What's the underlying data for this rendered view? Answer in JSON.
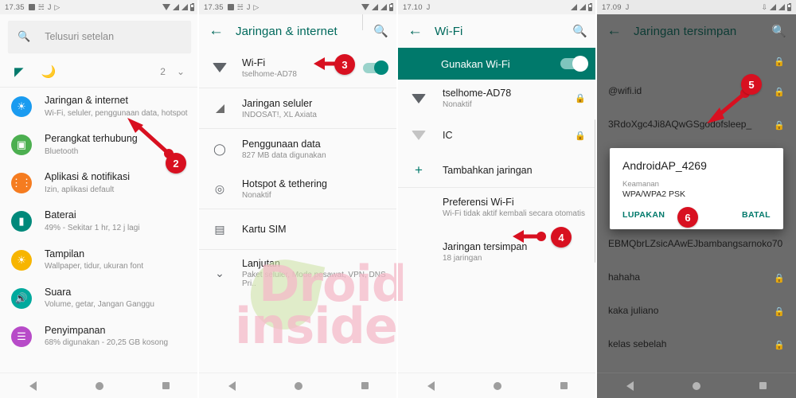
{
  "panels": [
    {
      "id": "settings",
      "statusbar": {
        "time": "17.35",
        "left_icons": [
          "square-icon",
          "message-icon",
          "jpay-icon",
          "play-icon"
        ],
        "right_icons": [
          "wifi-icon",
          "signal-icon",
          "signal-battery-icon"
        ]
      },
      "search": {
        "placeholder": "Telusuri setelan",
        "icon": "search-icon"
      },
      "quick": {
        "icons": [
          "signal-off-icon",
          "moon-icon"
        ],
        "count": "2",
        "chevron": "chevron-down-icon"
      },
      "items": [
        {
          "title": "Jaringan & internet",
          "subtitle": "Wi-Fi, seluler, penggunaan data, hotspot",
          "icon": "network-icon",
          "color": "#1a9bf0"
        },
        {
          "title": "Perangkat terhubung",
          "subtitle": "Bluetooth",
          "icon": "devices-icon",
          "color": "#4caf50"
        },
        {
          "title": "Aplikasi & notifikasi",
          "subtitle": "Izin, aplikasi default",
          "icon": "apps-icon",
          "color": "#f57c20"
        },
        {
          "title": "Baterai",
          "subtitle": "49% - Sekitar 1 hr, 12 j lagi",
          "icon": "battery-icon",
          "color": "#00897b"
        },
        {
          "title": "Tampilan",
          "subtitle": "Wallpaper, tidur, ukuran font",
          "icon": "display-icon",
          "color": "#f7b500"
        },
        {
          "title": "Suara",
          "subtitle": "Volume, getar, Jangan Ganggu",
          "icon": "sound-icon",
          "color": "#00a99d"
        },
        {
          "title": "Penyimpanan",
          "subtitle": "68% digunakan - 20,25 GB kosong",
          "icon": "storage-icon",
          "color": "#b74bc8"
        }
      ]
    },
    {
      "id": "network",
      "statusbar": {
        "time": "17.35"
      },
      "appbar": {
        "title": "Jaringan & internet",
        "back": "back-arrow-icon",
        "search": "search-icon"
      },
      "items": [
        {
          "title": "Wi-Fi",
          "subtitle": "tselhome-AD78",
          "icon": "wifi-icon",
          "toggle": true
        },
        {
          "title": "Jaringan seluler",
          "subtitle": "INDOSAT!, XL Axiata",
          "icon": "signal-icon"
        },
        {
          "title": "Penggunaan data",
          "subtitle": "827 MB data digunakan",
          "icon": "data-usage-icon"
        },
        {
          "title": "Hotspot & tethering",
          "subtitle": "Nonaktif",
          "icon": "hotspot-icon"
        },
        {
          "title": "Kartu SIM",
          "subtitle": "",
          "icon": "sim-card-icon"
        },
        {
          "title": "Lanjutan",
          "subtitle": "Paket seluler, Mode pesawat, VPN, DNS Pri..",
          "icon": "chevron-down-icon"
        }
      ]
    },
    {
      "id": "wifi",
      "statusbar": {
        "time": "17.10"
      },
      "appbar": {
        "title": "Wi-Fi",
        "back": "back-arrow-icon",
        "search": "search-icon"
      },
      "banner": {
        "label": "Gunakan Wi-Fi",
        "on": true
      },
      "networks": [
        {
          "name": "tselhome-AD78",
          "status": "Nonaktif",
          "locked": true,
          "strong": true
        },
        {
          "name": "IC",
          "status": "",
          "locked": true,
          "strong": false
        }
      ],
      "add_network": {
        "label": "Tambahkan jaringan",
        "icon": "plus-icon"
      },
      "prefs": {
        "title": "Preferensi Wi-Fi",
        "subtitle": "Wi-Fi tidak aktif kembali secara otomatis"
      },
      "saved": {
        "title": "Jaringan tersimpan",
        "subtitle": "18 jaringan"
      }
    },
    {
      "id": "saved",
      "statusbar": {
        "time": "17.09"
      },
      "appbar": {
        "title": "Jaringan tersimpan",
        "back": "back-arrow-icon",
        "search": "search-icon"
      },
      "networks": [
        {
          "name": "",
          "locked": true
        },
        {
          "name": "@wifi.id",
          "locked": true
        },
        {
          "name": "3RdoXgc4Ji8AQwGSgodofsleep_",
          "locked": true
        },
        {
          "name": "EBMQbrLZsicAAwEJbambangsarnoko70",
          "locked": false
        },
        {
          "name": "hahaha",
          "locked": true
        },
        {
          "name": "kaka juliano",
          "locked": true
        },
        {
          "name": "kelas sebelah",
          "locked": true
        }
      ],
      "dialog": {
        "title": "AndroidAP_4269",
        "security_label": "Keamanan",
        "security_value": "WPA/WPA2 PSK",
        "forget_label": "LUPAKAN",
        "cancel_label": "BATAL"
      }
    }
  ],
  "navbar": {
    "back": "nav-back-icon",
    "home": "nav-home-icon",
    "recents": "nav-recents-icon"
  },
  "markers": [
    {
      "label": "2"
    },
    {
      "label": "3"
    },
    {
      "label": "4"
    },
    {
      "label": "5"
    },
    {
      "label": "6"
    }
  ],
  "watermark": {
    "line1": "Droid",
    "line2": "inside",
    "color": "#f5b8c8"
  },
  "colors": {
    "teal": "#00796b",
    "marker_red": "#d81020",
    "accent": "#00897b"
  }
}
